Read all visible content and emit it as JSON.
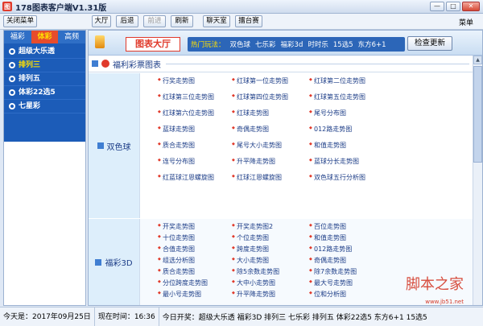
{
  "window": {
    "title": "178图表客户端V1.31版",
    "app_icon_glyph": "图",
    "controls": [
      "—",
      "□",
      "✕"
    ]
  },
  "toolbar": {
    "close_menu": "关闭菜单",
    "hall": "大厅",
    "back": "后退",
    "forward": "前进",
    "refresh": "刷新",
    "chatroom": "聊天室",
    "arena": "擂台赛",
    "menu": "菜单"
  },
  "left_panel": {
    "tabs": [
      "福彩",
      "体彩",
      "高频"
    ],
    "active_tab": 1,
    "items": [
      "超级大乐透",
      "排列三",
      "排列五",
      "体彩22选5",
      "七星彩"
    ],
    "selected_item": 1
  },
  "banner": {
    "brand": "图表大厅",
    "hot_label": "热门玩法：",
    "hot_links": [
      "双色球",
      "七乐彩",
      "福彩3d",
      "时时乐",
      "15选5",
      "东方6+1"
    ],
    "update_button": "检查更新"
  },
  "section": {
    "title": "福利彩票图表"
  },
  "groups": [
    {
      "name": "双色球",
      "links": [
        "行奖走势图",
        "红球第一位走势图",
        "红球第二位走势图",
        "红球第三位走势图",
        "红球第四位走势图",
        "红球第五位走势图",
        "红球第六位走势图",
        "红球走势图",
        "尾号分布图",
        "蓝球走势图",
        "奇偶走势图",
        "012路走势图",
        "质合走势图",
        "尾号大小走势图",
        "和值走势图",
        "连号分布图",
        "升平降走势图",
        "蓝球分长走势图",
        "红蓝球江恩螺旋图",
        "红球江恩螺旋图",
        "双色球五行分析图"
      ]
    },
    {
      "name": "福彩3D",
      "links": [
        "开奖走势图",
        "开奖走势图2",
        "百位走势图",
        "十位走势图",
        "个位走势图",
        "和值走势图",
        "合值走势图",
        "跨度走势图",
        "012路走势图",
        "组选分析图",
        "大小走势图",
        "奇偶走势图",
        "质合走势图",
        "除5余数走势图",
        "除7余数走势图",
        "分位跨度走势图",
        "大中小走势图",
        "最大号走势图",
        "最小号走势图",
        "升平降走势图",
        "位和分析图"
      ]
    }
  ],
  "status": {
    "today": "今天是：2017年09月25日",
    "now": "现在时间：16:36",
    "ticker": "今日开奖：超级大乐透 福彩3D 排列三 七乐彩 排列五 体彩22选5 东方6+1 15选5"
  },
  "watermark": {
    "text": "脚本之家",
    "sub": "www.jb51.net"
  },
  "colors": {
    "accent_blue": "#1c5cb8",
    "accent_red": "#e03a2b",
    "highlight_yellow": "#ffe000"
  }
}
